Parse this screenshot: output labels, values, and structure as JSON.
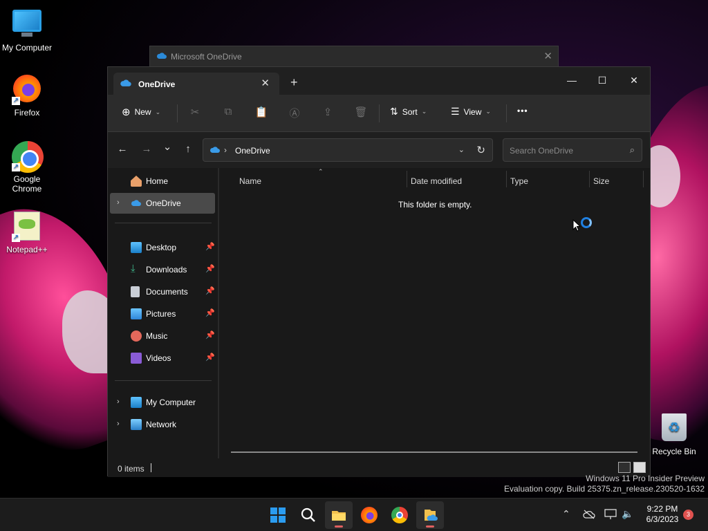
{
  "desktop": {
    "icons": [
      {
        "label": "My Computer"
      },
      {
        "label": "Firefox"
      },
      {
        "label": "Google Chrome"
      },
      {
        "label": "Notepad++"
      },
      {
        "label": "Recycle Bin"
      }
    ],
    "watermark": {
      "line1": "Windows 11 Pro Insider Preview",
      "line2": "Evaluation copy. Build 25375.zn_release.230520-1632"
    }
  },
  "background_window": {
    "title": "Microsoft OneDrive",
    "close_glyph": "✕"
  },
  "explorer": {
    "tab": {
      "label": "OneDrive",
      "close_glyph": "✕"
    },
    "new_tab_glyph": "+",
    "window_controls": {
      "minimize": "—",
      "maximize": "☐",
      "close": "✕"
    },
    "commandbar": {
      "new_label": "New",
      "sort_label": "Sort",
      "view_label": "View",
      "more_glyph": "•••"
    },
    "navigation": {
      "back": "←",
      "forward": "→",
      "recent": "⌄",
      "up": "↑"
    },
    "address": {
      "crumb": "OneDrive",
      "separator": "›"
    },
    "search": {
      "placeholder": "Search OneDrive"
    },
    "navpane": {
      "items": [
        {
          "label": "Home",
          "icon": "home-icon"
        },
        {
          "label": "OneDrive",
          "icon": "cloud-icon",
          "selected": true
        },
        {
          "label": "Desktop",
          "icon": "desktop-icon",
          "pinned": true
        },
        {
          "label": "Downloads",
          "icon": "download-icon",
          "pinned": true
        },
        {
          "label": "Documents",
          "icon": "document-icon",
          "pinned": true
        },
        {
          "label": "Pictures",
          "icon": "picture-icon",
          "pinned": true
        },
        {
          "label": "Music",
          "icon": "music-icon",
          "pinned": true
        },
        {
          "label": "Videos",
          "icon": "video-icon",
          "pinned": true
        },
        {
          "label": "My Computer",
          "icon": "computer-icon"
        },
        {
          "label": "Network",
          "icon": "network-icon"
        }
      ]
    },
    "columns": [
      "Name",
      "Date modified",
      "Type",
      "Size"
    ],
    "empty_message": "This folder is empty.",
    "status": {
      "item_count": "0 items"
    }
  },
  "taskbar": {
    "clock": {
      "time": "9:22 PM",
      "date": "6/3/2023"
    },
    "notification_count": "3"
  },
  "colors": {
    "accent": "#2b9cf0",
    "window_bg": "#191919",
    "toolbar_bg": "#2c2c2c",
    "selected_bg": "#4a4a4a"
  }
}
